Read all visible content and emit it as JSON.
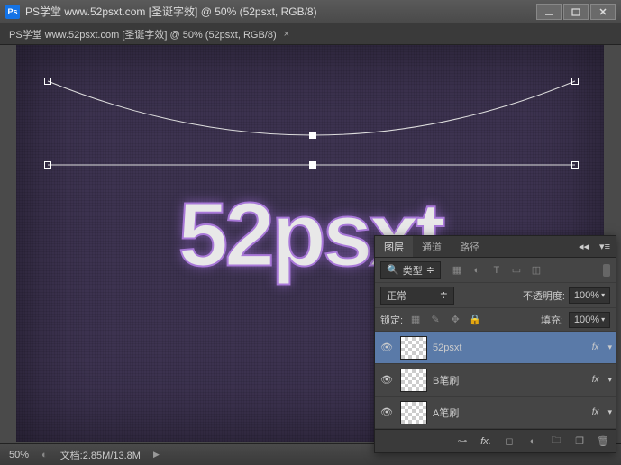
{
  "titlebar": {
    "app_title": "PS学堂  www.52psxt.com [圣诞字效] @ 50% (52psxt, RGB/8)"
  },
  "canvas": {
    "text_content": "52psxt"
  },
  "statusbar": {
    "zoom": "50%",
    "doc_label": "文档:",
    "doc_size": "2.85M/13.8M"
  },
  "layers_panel": {
    "tabs": {
      "layers": "图层",
      "channels": "通道",
      "paths": "路径"
    },
    "kind_filter": "类型",
    "blend_mode": "正常",
    "opacity_label": "不透明度:",
    "opacity_value": "100%",
    "lock_label": "锁定:",
    "fill_label": "填充:",
    "fill_value": "100%",
    "layers": [
      {
        "name": "52psxt",
        "fx": "fx"
      },
      {
        "name": "B笔刷",
        "fx": "fx"
      },
      {
        "name": "A笔刷",
        "fx": "fx"
      }
    ],
    "footer_link": "⊕"
  }
}
